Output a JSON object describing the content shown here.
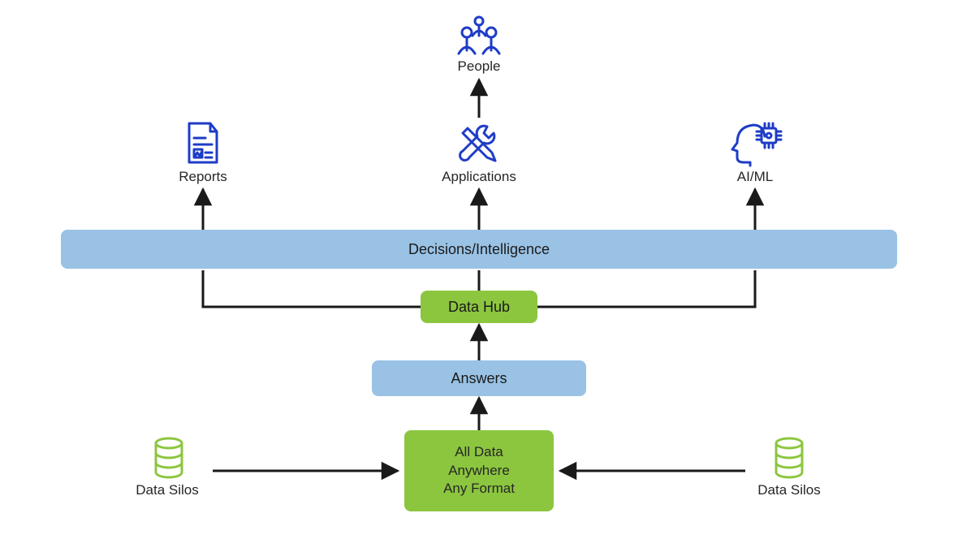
{
  "labels": {
    "people": "People",
    "reports": "Reports",
    "applications": "Applications",
    "aiml": "AI/ML",
    "decisions": "Decisions/Intelligence",
    "datahub": "Data Hub",
    "answers": "Answers",
    "alldata_l1": "All Data",
    "alldata_l2": "Anywhere",
    "alldata_l3": "Any Format",
    "silos_left": "Data Silos",
    "silos_right": "Data Silos"
  },
  "colors": {
    "icon_blue": "#1E3CC7",
    "icon_green": "#8CC63F",
    "pill_blue": "#99C2E5",
    "pill_green": "#8CC63F",
    "connector": "#1a1a1a"
  },
  "icon_names": {
    "people": "people-icon",
    "reports": "document-chart-icon",
    "applications": "tools-icon",
    "aiml": "ai-head-chip-icon",
    "silo": "database-icon"
  }
}
